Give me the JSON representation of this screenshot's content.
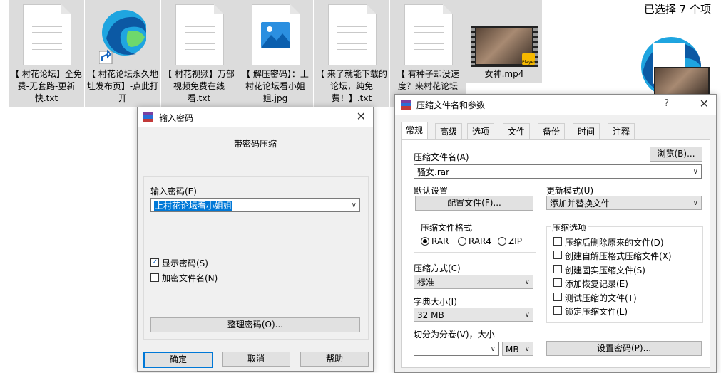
{
  "explorer": {
    "selected_count": "已选择 7 个项",
    "files": [
      {
        "name": "【 村花论坛】全免费-无套路-更新快.txt",
        "type": "txt"
      },
      {
        "name": "【 村花论坛永久地址发布页】-点此打开",
        "type": "edge"
      },
      {
        "name": "【 村花视频】万部视频免费在线看.txt",
        "type": "txt"
      },
      {
        "name": "【 解压密码】：上村花论坛看小姐姐.jpg",
        "type": "jpg"
      },
      {
        "name": "【 来了就能下载的论坛，纯免费！】.txt",
        "type": "txt"
      },
      {
        "name": "【 有种子却没速度？来村花论坛",
        "type": "txt"
      },
      {
        "name": "女神.mp4",
        "type": "mp4",
        "badge": "Player"
      }
    ]
  },
  "password_dialog": {
    "title": "输入密码",
    "heading": "带密码压缩",
    "password_label": "输入密码(E)",
    "password_value": "上村花论坛看小姐姐",
    "show_password_label": "显示密码(S)",
    "show_password_checked": true,
    "encrypt_names_label": "加密文件名(N)",
    "encrypt_names_checked": false,
    "organize_button": "整理密码(O)...",
    "ok_button": "确定",
    "cancel_button": "取消",
    "help_button": "帮助"
  },
  "archive_dialog": {
    "title": "压缩文件名和参数",
    "help_glyph": "?",
    "tabs": [
      "常规",
      "高级",
      "选项",
      "文件",
      "备份",
      "时间",
      "注释"
    ],
    "active_tab": "常规",
    "archive_name_label": "压缩文件名(A)",
    "browse_button": "浏览(B)...",
    "archive_name_value": "骚女.rar",
    "default_settings_label": "默认设置",
    "profiles_button": "配置文件(F)...",
    "update_mode_label": "更新模式(U)",
    "update_mode_value": "添加并替换文件",
    "format_label": "压缩文件格式",
    "formats": [
      "RAR",
      "RAR4",
      "ZIP"
    ],
    "selected_format": "RAR",
    "method_label": "压缩方式(C)",
    "method_value": "标准",
    "dict_label": "字典大小(I)",
    "dict_value": "32 MB",
    "split_label": "切分为分卷(V)，大小",
    "split_value": "",
    "split_unit": "MB",
    "options_label": "压缩选项",
    "options": [
      {
        "label": "压缩后删除原来的文件(D)",
        "checked": false
      },
      {
        "label": "创建自解压格式压缩文件(X)",
        "checked": false
      },
      {
        "label": "创建固实压缩文件(S)",
        "checked": false
      },
      {
        "label": "添加恢复记录(E)",
        "checked": false
      },
      {
        "label": "测试压缩的文件(T)",
        "checked": false
      },
      {
        "label": "锁定压缩文件(L)",
        "checked": false
      }
    ],
    "set_password_button": "设置密码(P)..."
  }
}
